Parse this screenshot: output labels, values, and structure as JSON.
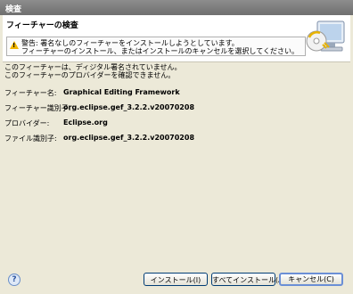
{
  "window": {
    "title": "検査"
  },
  "banner": {
    "heading": "フィーチャーの検査",
    "warning_line1": "警告: 署名なしのフィーチャーをインストールしようとしています。",
    "warning_line2": "フィーチャーのインストール、またはインストールのキャンセルを選択してください。"
  },
  "content": {
    "msg1": "このフィーチャーは、ディジタル署名されていません。",
    "msg2": "このフィーチャーのプロバイダーを確認できません。",
    "rows": [
      {
        "label": "フィーチャー名:",
        "value": "Graphical Editing Framework"
      },
      {
        "label": "フィーチャー識別子:",
        "value": "org.eclipse.gef_3.2.2.v20070208"
      },
      {
        "label": "プロバイダー:",
        "value": "Eclipse.org"
      },
      {
        "label": "ファイル識別子:",
        "value": "org.eclipse.gef_3.2.2.v20070208"
      }
    ]
  },
  "footer": {
    "help_symbol": "?",
    "install_label": "インストール(I)",
    "install_all_label": "すべてインストール(A)",
    "cancel_label": "キャンセル(C)"
  }
}
